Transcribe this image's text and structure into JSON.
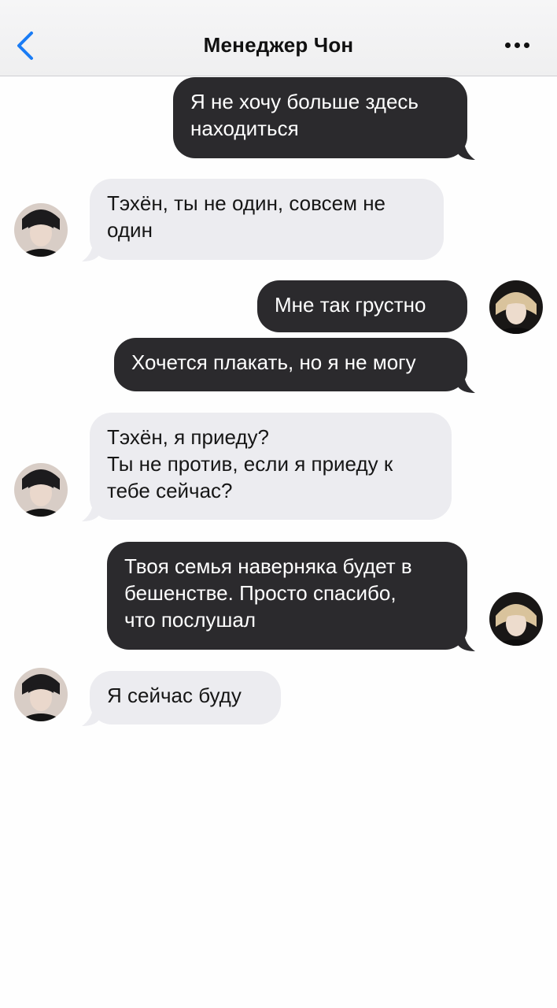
{
  "header": {
    "title": "Менеджер Чон"
  },
  "icons": {
    "back": "chevron-left-icon",
    "more": "ellipsis-icon"
  },
  "colors": {
    "accent": "#1a7cf5",
    "outgoing_bubble": "#2b2a2d",
    "incoming_bubble": "#ececf0"
  },
  "messages": [
    {
      "sender": "me",
      "text": "Я не хочу больше здесь\nнаходиться"
    },
    {
      "sender": "manager",
      "text": "Тэхён, ты не один, совсем не\nодин"
    },
    {
      "sender": "me",
      "text": "Мне так грустно"
    },
    {
      "sender": "me",
      "text": "Хочется плакать, но я не могу"
    },
    {
      "sender": "manager",
      "text": "Тэхён, я приеду?\nТы не против, если я приеду к\nтебе сейчас?"
    },
    {
      "sender": "me",
      "text": "Твоя семья наверняка будет в\nбешенстве. Просто спасибо,\nчто послушал"
    },
    {
      "sender": "manager",
      "text": "Я сейчас буду"
    }
  ]
}
